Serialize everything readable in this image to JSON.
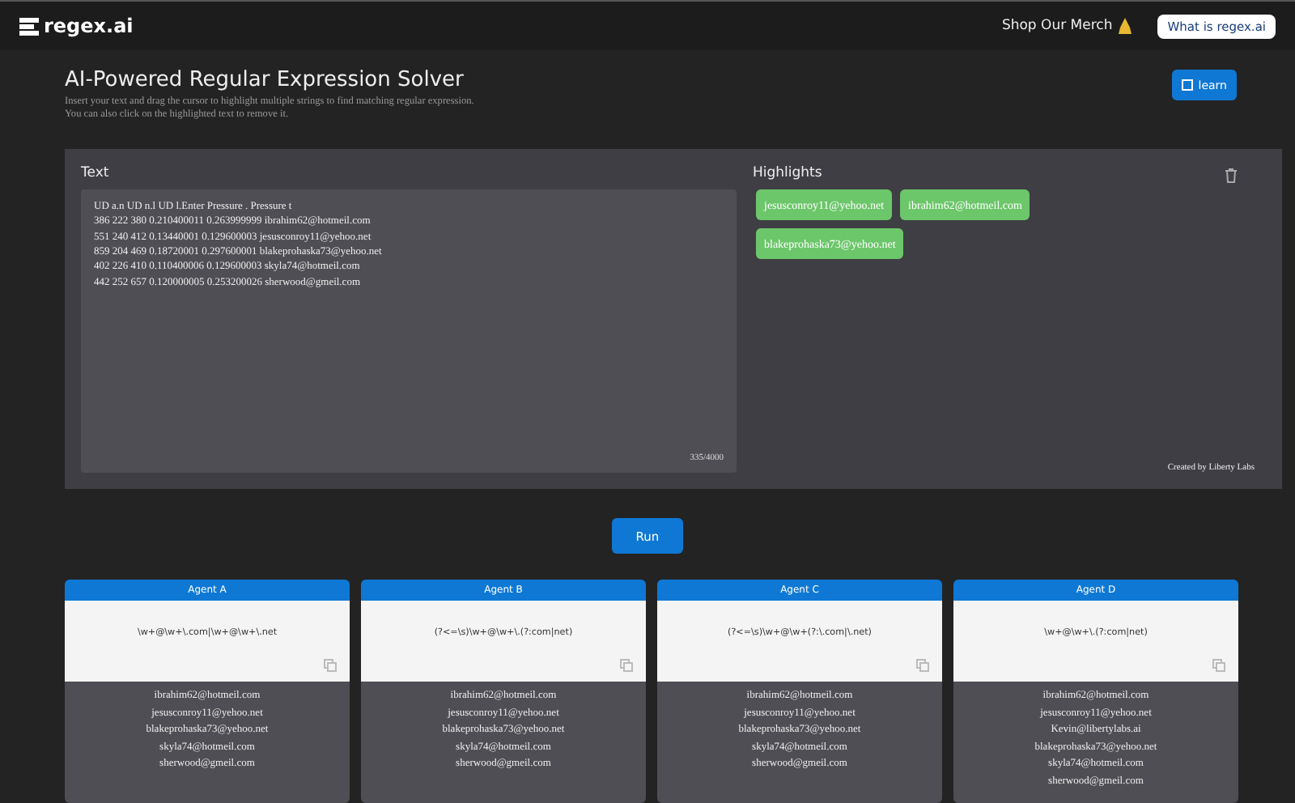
{
  "header": {
    "logo": "regex.ai",
    "merch_link": "Shop Our Merch",
    "about_button": "What is regex.ai"
  },
  "intro": {
    "title": "AI-Powered Regular Expression Solver",
    "description": "Insert your text and drag the cursor to highlight multiple strings to find matching regular expression.\nYou can also click on the highlighted text to remove it.",
    "learn_button": "learn"
  },
  "text_panel": {
    "label": "Text",
    "lines": [
      "UD a.n UD n.l UD l.Enter Pressure . Pressure t",
      "386 222 380 0.210400011 0.263999999 ibrahim62@hotmeil.com",
      "551 240 412 0.13440001 0.129600003 jesusconroy11@yehoo.net",
      "859 204 469 0.18720001 0.297600001 blakeprohaska73@yehoo.net",
      "402 226 410 0.110400006 0.129600003 skyla74@hotmeil.com",
      "442 252 657 0.120000005 0.253200026 sherwood@gmeil.com"
    ],
    "char_count": "335/4000"
  },
  "highlights": {
    "label": "Highlights",
    "items": [
      "jesusconroy11@yehoo.net",
      "ibrahim62@hotmeil.com",
      "blakeprohaska73@yehoo.net"
    ],
    "credit": "Created by Liberty Labs"
  },
  "run_button": "Run",
  "agents": [
    {
      "name": "Agent A",
      "regex": "\\w+@\\w+\\.com|\\w+@\\w+\\.net",
      "matches": [
        "ibrahim62@hotmeil.com",
        "jesusconroy11@yehoo.net",
        "blakeprohaska73@yehoo.net",
        "skyla74@hotmeil.com",
        "sherwood@gmeil.com"
      ]
    },
    {
      "name": "Agent B",
      "regex": "(?<=\\s)\\w+@\\w+\\.(?:com|net)",
      "matches": [
        "ibrahim62@hotmeil.com",
        "jesusconroy11@yehoo.net",
        "blakeprohaska73@yehoo.net",
        "skyla74@hotmeil.com",
        "sherwood@gmeil.com"
      ]
    },
    {
      "name": "Agent C",
      "regex": "(?<=\\s)\\w+@\\w+(?:\\.com|\\.net)",
      "matches": [
        "ibrahim62@hotmeil.com",
        "jesusconroy11@yehoo.net",
        "blakeprohaska73@yehoo.net",
        "skyla74@hotmeil.com",
        "sherwood@gmeil.com"
      ]
    },
    {
      "name": "Agent D",
      "regex": "\\w+@\\w+\\.(?:com|net)",
      "matches": [
        "ibrahim62@hotmeil.com",
        "jesusconroy11@yehoo.net",
        "Kevin@libertylabs.ai",
        "blakeprohaska73@yehoo.net",
        "skyla74@hotmeil.com",
        "sherwood@gmeil.com"
      ]
    }
  ]
}
